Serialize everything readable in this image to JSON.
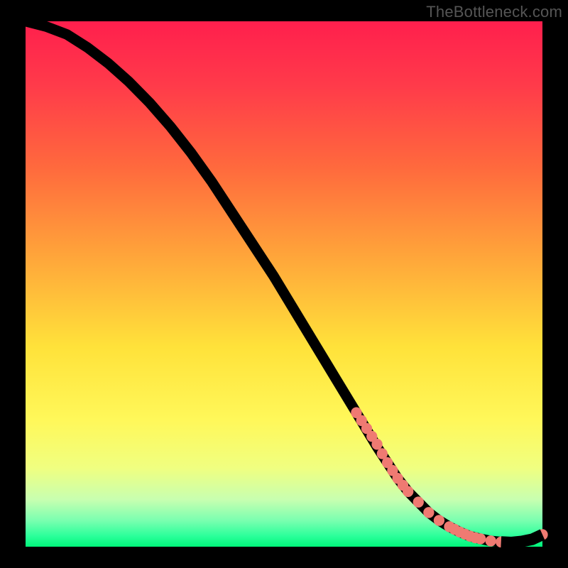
{
  "watermark": "TheBottleneck.com",
  "colors": {
    "background": "#000000",
    "gradient_top": "#ff1f4d",
    "gradient_bottom": "#00f57a",
    "curve": "#000000",
    "dots": "#ef7a72"
  },
  "chart_data": {
    "type": "line",
    "title": "",
    "xlabel": "",
    "ylabel": "",
    "xlim": [
      0,
      100
    ],
    "ylim": [
      0,
      100
    ],
    "grid": false,
    "legend": false,
    "series": [
      {
        "name": "bottleneck-curve",
        "x": [
          0,
          4,
          8,
          12,
          16,
          20,
          24,
          28,
          32,
          36,
          40,
          44,
          48,
          52,
          56,
          60,
          64,
          68,
          70,
          72,
          74,
          76,
          78,
          80,
          82,
          84,
          86,
          88,
          90,
          92,
          94,
          96,
          98,
          100
        ],
        "y": [
          100,
          99,
          97.5,
          95,
          92,
          88.5,
          84.5,
          80,
          75,
          69.5,
          63.5,
          57.5,
          51.5,
          45,
          38.5,
          32,
          25.5,
          19,
          16,
          13,
          10.5,
          8.5,
          6.5,
          5,
          3.8,
          2.8,
          2,
          1.5,
          1.1,
          0.9,
          0.8,
          1,
          1.4,
          2.3
        ]
      }
    ],
    "highlighted_points": {
      "name": "dots",
      "x": [
        64,
        65,
        66,
        67,
        68,
        69,
        70,
        71,
        72,
        73,
        74,
        76,
        78,
        80,
        82,
        83,
        84,
        85,
        86,
        87,
        88,
        90,
        92,
        93,
        94,
        96,
        98,
        99,
        100
      ],
      "y": [
        25.5,
        24,
        22.5,
        21,
        19.5,
        17.7,
        16,
        14.5,
        13,
        11.7,
        10.5,
        8.5,
        6.5,
        5,
        3.8,
        3.3,
        2.8,
        2.4,
        2,
        1.7,
        1.5,
        1.1,
        0.9,
        0.85,
        0.8,
        1,
        1.4,
        1.8,
        2.3
      ]
    }
  }
}
